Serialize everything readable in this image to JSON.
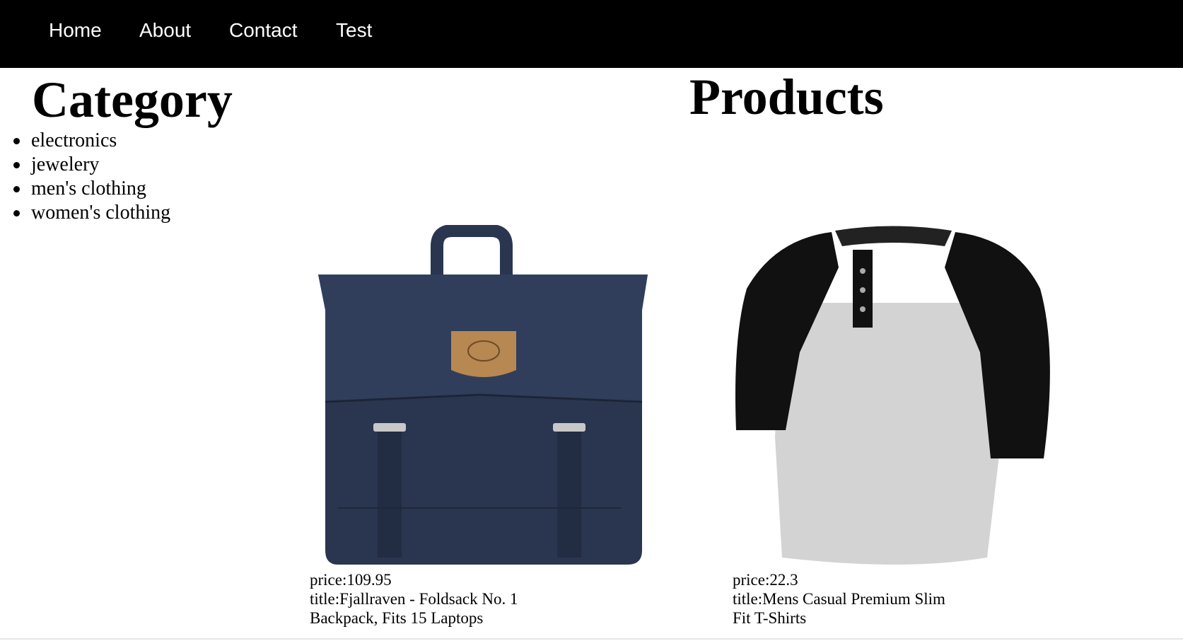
{
  "nav": {
    "items": [
      {
        "label": "Home"
      },
      {
        "label": "About"
      },
      {
        "label": "Contact"
      },
      {
        "label": "Test"
      }
    ]
  },
  "sidebar": {
    "title": "Category",
    "categories": [
      {
        "label": "electronics"
      },
      {
        "label": "jewelery"
      },
      {
        "label": "men's clothing"
      },
      {
        "label": "women's clothing"
      }
    ]
  },
  "main": {
    "title": "Products",
    "products": [
      {
        "price_text": "price:109.95",
        "title_text": "title:Fjallraven - Foldsack No. 1 Backpack, Fits 15 Laptops",
        "image_icon": "navy-backpack-image",
        "color": "#2a3650"
      },
      {
        "price_text": "price:22.3",
        "title_text": "title:Mens Casual Premium Slim Fit T-Shirts",
        "image_icon": "raglan-tshirt-image",
        "color": "#d3d3d3"
      }
    ]
  }
}
